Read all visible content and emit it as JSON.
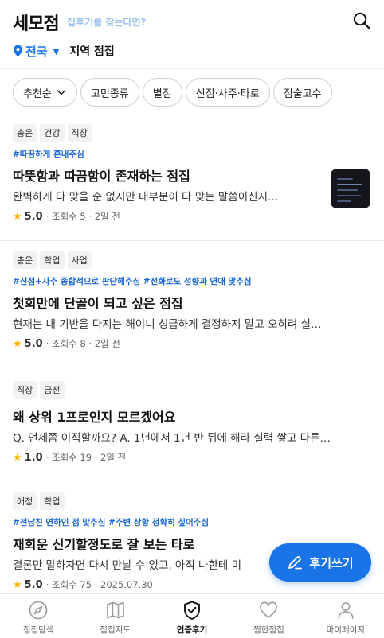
{
  "header": {
    "logo": "세모점",
    "logo_sub": "집후기를 찾는다면?",
    "region": "전국",
    "region_label": "지역 점집"
  },
  "filters": [
    {
      "label": "추천순",
      "has_caret": true
    },
    {
      "label": "고민종류"
    },
    {
      "label": "별점"
    },
    {
      "label": "신점·사주·타로"
    },
    {
      "label": "점술고수"
    }
  ],
  "posts": [
    {
      "tags": [
        "총운",
        "건강",
        "직장"
      ],
      "hashtags": "#따끔하게 혼내주심",
      "title": "따뜻함과 따끔함이 존재하는 점집",
      "excerpt": "완벽하게 다 맞을 순 없지만 대부분이 다 맞는 말씀이신지…",
      "rating": "5.0",
      "views": "조회수 5",
      "date": "2일 전",
      "has_thumbnail": true
    },
    {
      "tags": [
        "총운",
        "학업",
        "사업"
      ],
      "hashtags": "#신점+사주 종합적으로 판단해주심 #전화로도 성향과 연애 맞추심",
      "title": "첫회만에 단골이 되고 싶은 점집",
      "excerpt": "현재는 내 기반을 다지는 해이니 성급하게 결정하지 말고 오히려 실…",
      "rating": "5.0",
      "views": "조회수 8",
      "date": "2일 전",
      "has_thumbnail": false
    },
    {
      "tags": [
        "직장",
        "금전"
      ],
      "hashtags": "",
      "title": "왜 상위 1프로인지 모르겠어요",
      "excerpt": "Q. 언제쯤 이직할까요? A. 1년에서 1년 반 뒤에 해라 실력 쌓고 다른…",
      "rating": "1.0",
      "views": "조회수 19",
      "date": "2일 전",
      "has_thumbnail": false
    },
    {
      "tags": [
        "애정",
        "학업"
      ],
      "hashtags": "#전남친 연하인 점 맞추심 #주변 상황 정확히 짚어주심",
      "title": "재회운 신기할정도로 잘 보는 타로",
      "excerpt": "결론만 말하자면 다시 만날 수 있고, 아직 나한테 미",
      "rating": "5.0",
      "views": "조회수 75",
      "date": "2025.07.30",
      "has_thumbnail": false
    }
  ],
  "fab": {
    "label": "후기쓰기"
  },
  "tabs": [
    {
      "label": "점집탐색",
      "icon": "compass-icon"
    },
    {
      "label": "점집지도",
      "icon": "map-icon"
    },
    {
      "label": "인증후기",
      "icon": "shield-check-icon",
      "active": true
    },
    {
      "label": "찜한점집",
      "icon": "heart-icon"
    },
    {
      "label": "마이페이지",
      "icon": "person-icon"
    }
  ],
  "colors": {
    "accent": "#1a74e8",
    "star": "#f5b400",
    "hashtag": "#1a66d9"
  }
}
